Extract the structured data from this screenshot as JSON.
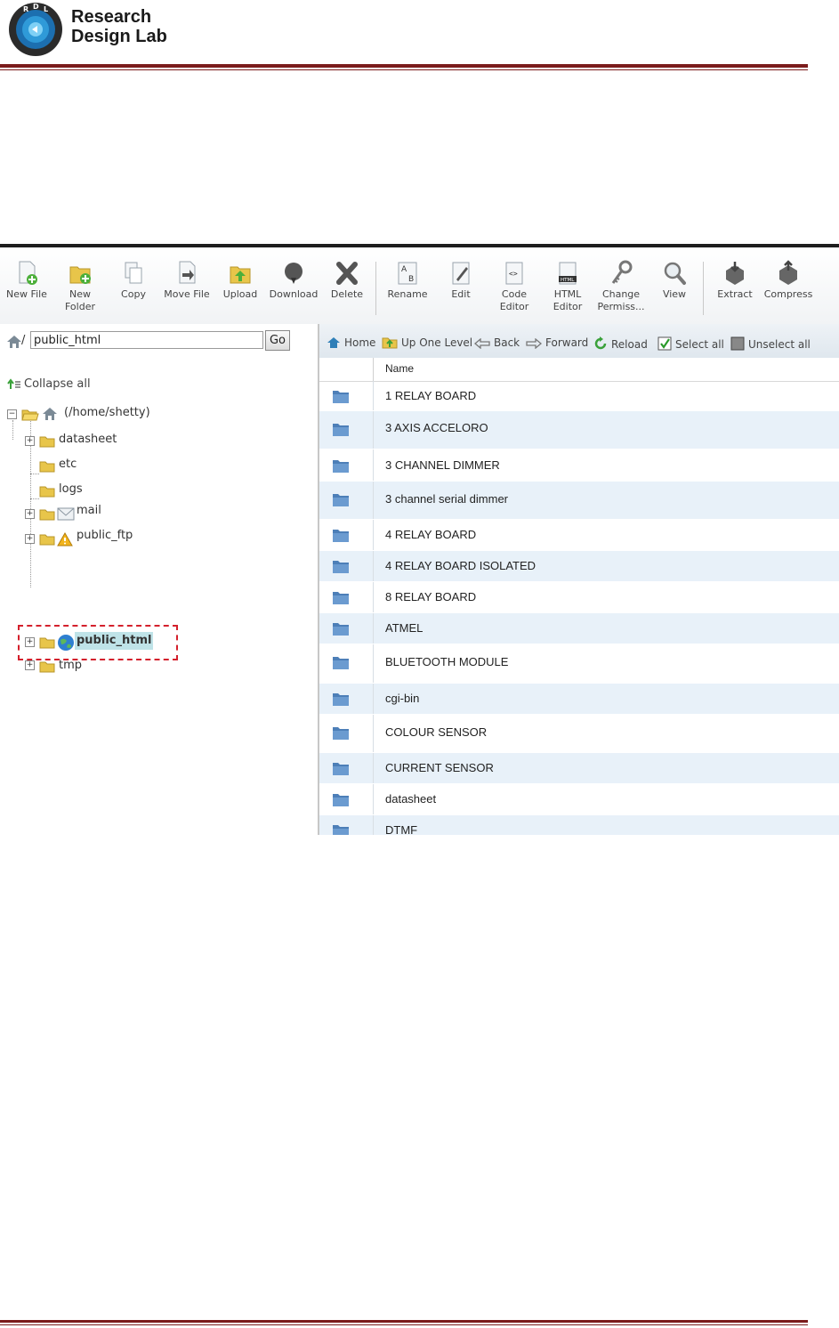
{
  "header": {
    "brand_line1": "Research",
    "brand_line2": "Design Lab",
    "logo_letters": "RDL",
    "rule_color": "#7b1c1c"
  },
  "toolbar": {
    "buttons": [
      {
        "label": "New File",
        "icon": "new-file-icon"
      },
      {
        "label": "New Folder",
        "icon": "new-folder-icon"
      },
      {
        "label": "Copy",
        "icon": "copy-icon"
      },
      {
        "label": "Move File",
        "icon": "move-file-icon"
      },
      {
        "label": "Upload",
        "icon": "upload-icon"
      },
      {
        "label": "Download",
        "icon": "download-icon"
      },
      {
        "label": "Delete",
        "icon": "delete-icon"
      },
      {
        "label": "Rename",
        "icon": "rename-icon"
      },
      {
        "label": "Edit",
        "icon": "edit-icon"
      },
      {
        "label": "Code Editor",
        "icon": "code-editor-icon"
      },
      {
        "label": "HTML Editor",
        "icon": "html-editor-icon"
      },
      {
        "label": "Change Permiss...",
        "icon": "permissions-icon"
      },
      {
        "label": "View",
        "icon": "view-icon"
      },
      {
        "label": "Extract",
        "icon": "extract-icon"
      },
      {
        "label": "Compress",
        "icon": "compress-icon"
      }
    ]
  },
  "sidebar": {
    "path_prefix": "/",
    "path_value": "public_html",
    "go_label": "Go",
    "collapse_label": "Collapse all",
    "root_label": "(/home/shetty)",
    "tree": [
      {
        "label": "datasheet",
        "expandable": true
      },
      {
        "label": "etc",
        "expandable": false
      },
      {
        "label": "logs",
        "expandable": false
      },
      {
        "label": "mail",
        "expandable": true
      },
      {
        "label": "public_ftp",
        "expandable": true
      },
      {
        "label": "public_html",
        "expandable": true,
        "selected": true
      },
      {
        "label": "tmp",
        "expandable": true
      }
    ]
  },
  "nav": {
    "home": "Home",
    "up": "Up One Level",
    "back": "Back",
    "forward": "Forward",
    "reload": "Reload",
    "select_all": "Select all",
    "unselect_all": "Unselect all"
  },
  "table": {
    "column_name": "Name",
    "rows": [
      {
        "name": "1 RELAY BOARD"
      },
      {
        "name": "3 AXIS ACCELORO"
      },
      {
        "name": "3 CHANNEL DIMMER"
      },
      {
        "name": "3 channel serial dimmer"
      },
      {
        "name": "4 RELAY BOARD"
      },
      {
        "name": "4 RELAY BOARD ISOLATED"
      },
      {
        "name": "8 RELAY BOARD"
      },
      {
        "name": "ATMEL"
      },
      {
        "name": "BLUETOOTH MODULE"
      },
      {
        "name": "cgi-bin"
      },
      {
        "name": "COLOUR SENSOR"
      },
      {
        "name": "CURRENT SENSOR"
      },
      {
        "name": "datasheet"
      },
      {
        "name": "DTMF"
      }
    ]
  },
  "colors": {
    "row_alt": "#e8f1f9",
    "folder_blue": "#4d7fb8",
    "highlight_border": "#d4202c",
    "selection_bg": "#bfe3e8"
  }
}
